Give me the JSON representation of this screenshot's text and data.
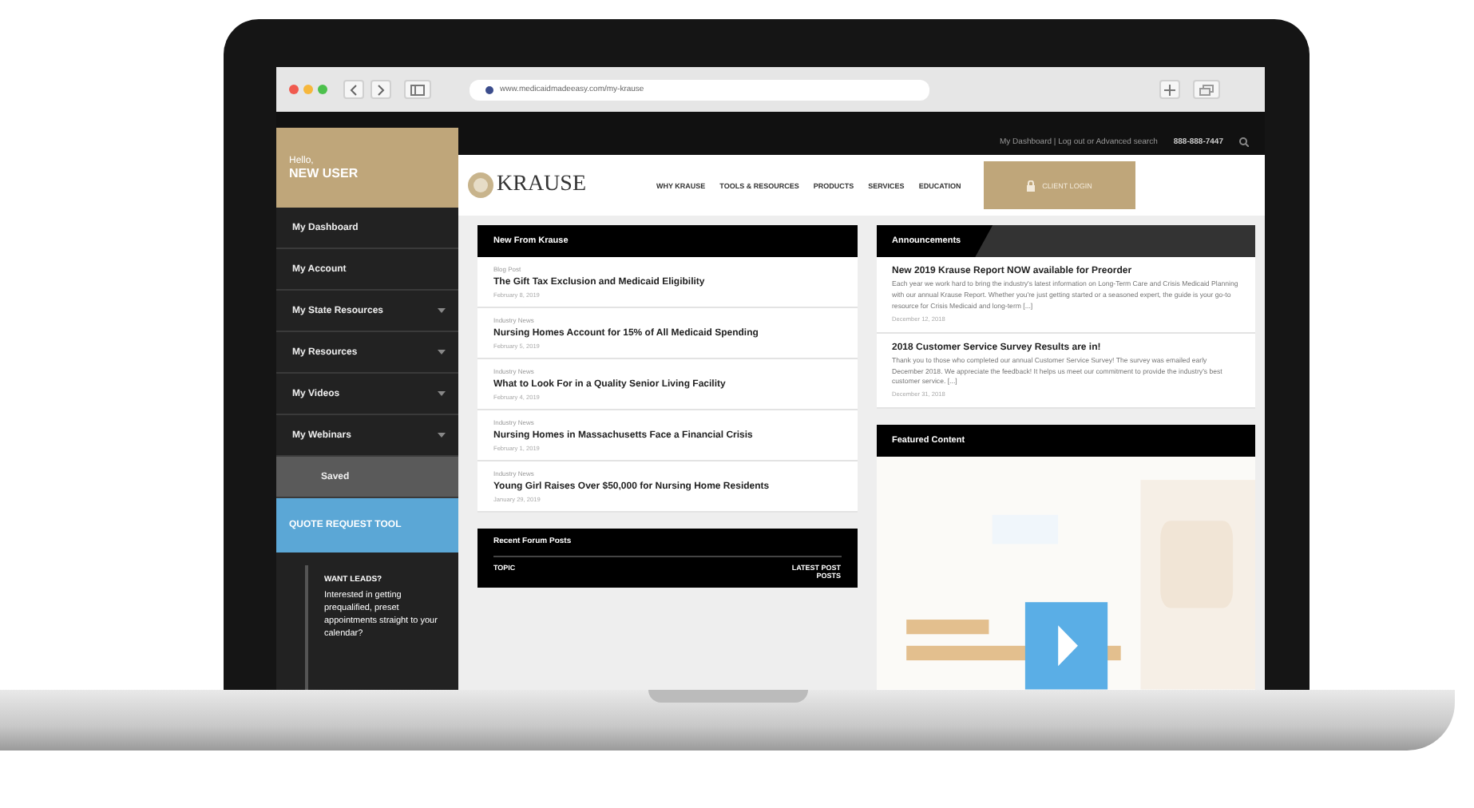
{
  "browser": {
    "url": "www.medicaidmadeeasy.com/my-krause"
  },
  "top_bar": {
    "links": "My Dashboard | Log out or Advanced search",
    "phone": "888-888-7447"
  },
  "sidebar": {
    "greeting": "Hello,",
    "user": "NEW USER",
    "items": [
      {
        "label": "My Dashboard",
        "expandable": false,
        "selected": false
      },
      {
        "label": "My Account",
        "expandable": false,
        "selected": false
      },
      {
        "label": "My State Resources",
        "expandable": true,
        "selected": false
      },
      {
        "label": "My Resources",
        "expandable": true,
        "selected": false
      },
      {
        "label": "My Videos",
        "expandable": true,
        "selected": false
      },
      {
        "label": "My Webinars",
        "expandable": true,
        "selected": false
      },
      {
        "label": "Saved",
        "expandable": false,
        "selected": true
      }
    ],
    "quote_button": "QUOTE REQUEST TOOL",
    "promo": {
      "title": "WANT LEADS?",
      "text": "Interested in getting prequalified, preset appointments straight to your calendar?"
    }
  },
  "header": {
    "logo": "KRAUSE",
    "nav": [
      "WHY KRAUSE",
      "TOOLS & RESOURCES",
      "PRODUCTS",
      "SERVICES",
      "EDUCATION"
    ],
    "portal_button": "CLIENT LOGIN"
  },
  "news": {
    "title": "New From Krause",
    "posts": [
      {
        "category": "Blog Post",
        "title": "The Gift Tax Exclusion and Medicaid Eligibility",
        "date": "February 8, 2019"
      },
      {
        "category": "Industry News",
        "title": "Nursing Homes Account for 15% of All Medicaid Spending",
        "date": "February 5, 2019"
      },
      {
        "category": "Industry News",
        "title": "What to Look For in a Quality Senior Living Facility",
        "date": "February 4, 2019"
      },
      {
        "category": "Industry News",
        "title": "Nursing Homes in Massachusetts Face a Financial Crisis",
        "date": "February 1, 2019"
      },
      {
        "category": "Industry News",
        "title": "Young Girl Raises Over $50,000 for Nursing Home Residents",
        "date": "January 29, 2019"
      }
    ]
  },
  "forum": {
    "title": "Recent Forum Posts",
    "columns": [
      "TOPIC",
      "LATEST POST",
      "POSTS"
    ]
  },
  "announcements": {
    "title": "Announcements",
    "items": [
      {
        "title": "New 2019 Krause Report NOW available for Preorder",
        "text": "Each year we work hard to bring the industry's latest information on Long-Term Care and Crisis Medicaid Planning with our annual Krause Report. Whether you're just getting started or a seasoned expert, the guide is your go-to resource for Crisis Medicaid and long-term [...]",
        "date": "December 12, 2018"
      },
      {
        "title": "2018 Customer Service Survey Results are in!",
        "text": "Thank you to those who completed our annual Customer Service Survey! The survey was emailed early December 2018. We appreciate the feedback! It helps us meet our commitment to provide the industry's best customer service. [...]",
        "date": "December 31, 2018"
      }
    ]
  },
  "featured": {
    "title": "Featured Content"
  }
}
